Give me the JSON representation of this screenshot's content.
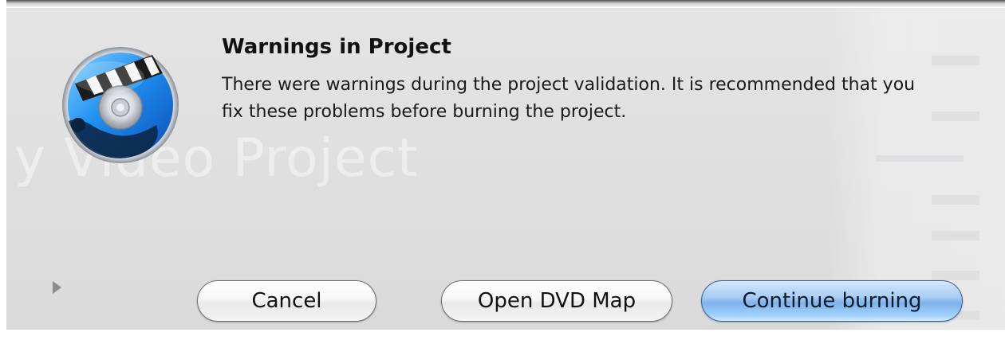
{
  "dialog": {
    "title": "Warnings in Project",
    "message": "There were warnings during the project validation. It is recommended that you fix these problems before burning the project.",
    "icon": "idvd-app-icon",
    "disclosure_icon": "disclosure-triangle-icon"
  },
  "buttons": {
    "cancel_label": "Cancel",
    "open_map_label": "Open DVD Map",
    "continue_label": "Continue burning"
  },
  "colors": {
    "default_button": "#9fc7f3",
    "sheet_background": "#e0e0e0"
  }
}
